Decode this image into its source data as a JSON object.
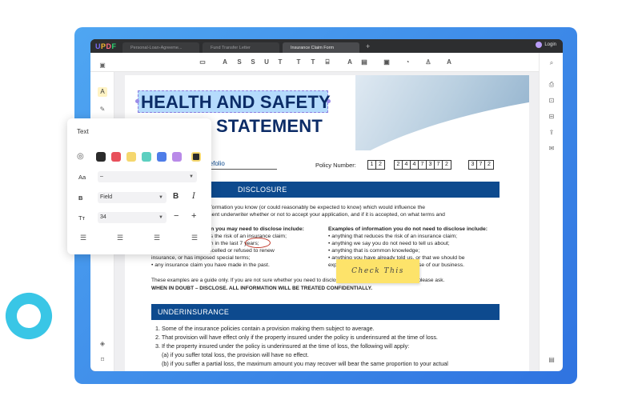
{
  "app": {
    "logo": {
      "u": "U",
      "p": "P",
      "d": "D",
      "f": "F"
    },
    "tabs": [
      "Personal-Loan-Agreeme...",
      "Fund Transfer Letter",
      "Insurance Claim Form"
    ],
    "tab_add": "+",
    "login_label": "Login"
  },
  "toolbar": {
    "tools": [
      "▭",
      "A",
      "S",
      "S",
      "U",
      "T",
      "T",
      "T",
      "⌸",
      "A",
      "▤",
      "▣",
      "◔",
      "♙",
      "A"
    ]
  },
  "text_popup": {
    "title": "Text",
    "colors": [
      "#2b2b2b",
      "#e8505b",
      "#f5d76e",
      "#5ccfc0",
      "#4f7de8",
      "#b98ae8",
      "#2b2b2b"
    ],
    "font_label": "Aa",
    "font_value": "–",
    "weight_label": "B",
    "weight_value": "Field",
    "bold_label": "B",
    "italic_label": "I",
    "size_label": "Tт",
    "size_value": "34",
    "minus_label": "−",
    "plus_label": "+",
    "align_icons": [
      "left-align-icon",
      "center-align-icon",
      "right-align-icon",
      "justify-icon"
    ]
  },
  "document": {
    "title_line1": "HEALTH AND SAFETY",
    "title_line2": "STATEMENT",
    "name_fragment": "refolio",
    "policy_label": "Policy Number:",
    "policy_groups": [
      [
        "1",
        "2"
      ],
      [
        "2",
        "4",
        "4",
        "7",
        "3",
        "7",
        "2"
      ],
      [
        "3",
        "7",
        "2"
      ]
    ],
    "disclosure_heading": "DISCLOSURE",
    "intro_lines": [
      "nformation you know (or could reasonably be expected to know) which would influence the",
      "ment underwriter whether or not to accept your application, and if it is accepted, on what terms and"
    ],
    "left_heading": "on you may need to disclose include:",
    "left_items": [
      "es the risk of an insurance claim;",
      "on in the last 7 years;",
      "r another insurer has cancelled or refused to renew",
      "insurance, or has imposed special terms;",
      "• any insurance claim you have made in the past."
    ],
    "right_heading": "Examples of information you do not need to disclose include:",
    "right_items": [
      "• anything that reduces the risk of an insurance claim;",
      "• anything we say you do not need to tell us about;",
      "• anything that is common knowledge;",
      "• anything you have already told us, or that we should be",
      "expected to know in the ordinary course of our business."
    ],
    "guide_line": "These examples are a guide only. If you are not sure whether you need to disclose a particular piece of information, please ask.",
    "doubt_line": "WHEN IN DOUBT – DISCLOSE. ALL INFORMATION WILL BE TREATED CONFIDENTIALLY.",
    "underinsurance_heading": "UNDERINSURANCE",
    "under_items": [
      "1. Some of the insurance policies contain a provision making them subject to average.",
      "2. That provision will have effect only if the property insured under the policy is underinsured at the time of loss.",
      "3. If the property insured under the policy is underinsured at the time of loss, the following will apply:",
      "(a) if you suffer total loss, the provision will have no effect.",
      "(b) if you suffer a partial loss, the maximum amount you may recover will bear the same proportion to your actual"
    ],
    "sticky_note": "Check This"
  }
}
